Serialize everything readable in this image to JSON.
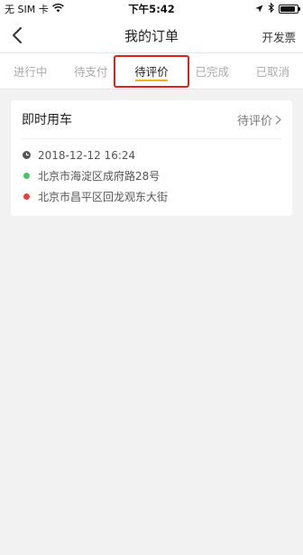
{
  "status_bar": {
    "carrier": "无 SIM 卡",
    "time": "下午5:42",
    "battery_level": 0.9
  },
  "nav": {
    "title": "我的订单",
    "action": "开发票"
  },
  "tabs": [
    {
      "label": "进行中"
    },
    {
      "label": "待支付"
    },
    {
      "label": "待评价",
      "active": true
    },
    {
      "label": "已完成"
    },
    {
      "label": "已取消"
    }
  ],
  "order": {
    "type": "即时用车",
    "status": "待评价",
    "datetime": "2018-12-12 16:24",
    "from": "北京市海淀区成府路28号",
    "to": "北京市昌平区回龙观东大街"
  },
  "colors": {
    "accent": "#f3b21a",
    "highlight": "#e0221b",
    "origin_dot": "#4cc36a",
    "destination_dot": "#e8423a"
  },
  "icons": [
    "wifi-icon",
    "location-arrow-icon",
    "bluetooth-icon",
    "battery-icon",
    "back-arrow-icon",
    "chevron-right-icon",
    "clock-icon"
  ]
}
